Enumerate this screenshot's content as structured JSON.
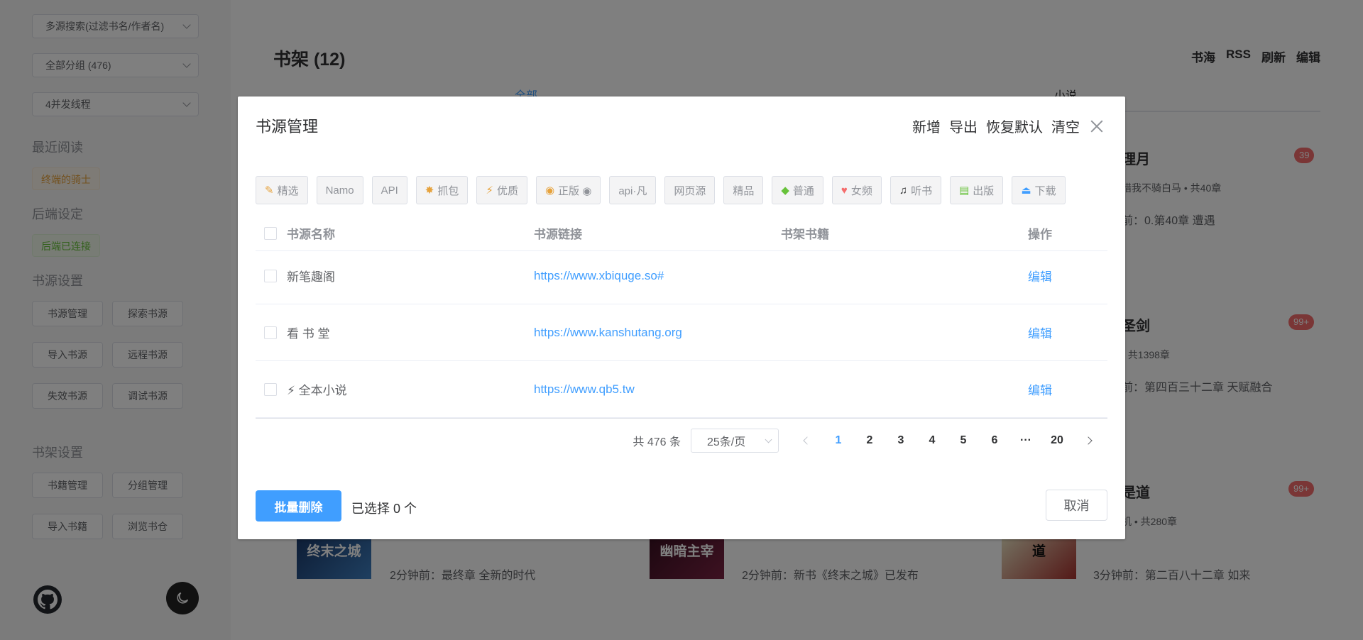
{
  "sidebar": {
    "selects": [
      "多源搜索(过滤书名/作者名)",
      "全部分组 (476)",
      "4并发线程"
    ],
    "recent_title": "最近阅读",
    "recent_book": "终端的骑士",
    "backend_title": "后端设定",
    "backend_status": "后端已连接",
    "source_title": "书源设置",
    "source_buttons": [
      "书源管理",
      "探索书源",
      "导入书源",
      "远程书源",
      "失效书源",
      "调试书源"
    ],
    "shelf_title": "书架设置",
    "shelf_buttons": [
      "书籍管理",
      "分组管理",
      "导入书籍",
      "浏览书仓"
    ]
  },
  "main": {
    "title": "书架 (12)",
    "links": [
      "书海",
      "RSS",
      "刷新",
      "编辑"
    ],
    "tabs": [
      "全部",
      "小说"
    ],
    "books": [
      {
        "name": "理月",
        "badge": "39",
        "meta": "惜我不骑白马 • 共40章",
        "latest": "前：0.第40章 遭遇"
      },
      {
        "name": "圣剑",
        "badge": "99+",
        "meta": "• 共1398章",
        "latest": "前：第四百三十二章 天赋融合"
      },
      {
        "name": "是道",
        "badge": "99+",
        "meta": "机 • 共280章",
        "latest": ""
      }
    ],
    "bottom_rows": [
      {
        "cover": "终末之城",
        "latest": "2分钟前：最终章 全新的时代"
      },
      {
        "cover": "幽暗主宰",
        "latest": "2分钟前：新书《终末之城》已发布"
      },
      {
        "cover": "道",
        "latest": "3分钟前：第二百八十二章 如来"
      }
    ]
  },
  "dialog": {
    "title": "书源管理",
    "actions": [
      "新增",
      "导出",
      "恢复默认",
      "清空"
    ],
    "chips": [
      {
        "icon": "✎",
        "label": "精选"
      },
      {
        "icon": "",
        "label": "Namo"
      },
      {
        "icon": "",
        "label": "API"
      },
      {
        "icon": "✸",
        "label": "抓包"
      },
      {
        "icon": "⚡",
        "label": "优质"
      },
      {
        "icon": "◉",
        "label": "正版 ◉"
      },
      {
        "icon": "",
        "label": "api·凡"
      },
      {
        "icon": "",
        "label": "网页源"
      },
      {
        "icon": "",
        "label": "精品"
      },
      {
        "icon": "◆",
        "label": "普通"
      },
      {
        "icon": "♥",
        "label": "女频"
      },
      {
        "icon": "♫",
        "label": "听书"
      },
      {
        "icon": "▤",
        "label": "出版"
      },
      {
        "icon": "⏏",
        "label": "下载"
      }
    ],
    "columns": [
      "书源名称",
      "书源链接",
      "书架书籍",
      "操作"
    ],
    "rows": [
      {
        "name": "新笔趣阁",
        "url": "https://www.xbiquge.so#",
        "shelf": "",
        "op": "编辑"
      },
      {
        "name": "看 书 堂",
        "url": "https://www.kanshutang.org",
        "shelf": "",
        "op": "编辑"
      },
      {
        "name": "⚡ 全本小说",
        "url": "https://www.qb5.tw",
        "shelf": "",
        "op": "编辑"
      }
    ],
    "pager": {
      "total": "共 476 条",
      "page_size": "25条/页",
      "pages": [
        "1",
        "2",
        "3",
        "4",
        "5",
        "6",
        "···",
        "20"
      ],
      "current": "1"
    },
    "batch_delete": "批量删除",
    "selected": "已选择 0 个",
    "cancel": "取消"
  },
  "colors": {
    "accent": "#409eff",
    "danger": "#f56c6c",
    "success": "#67c23a",
    "warning": "#e6a23c"
  }
}
